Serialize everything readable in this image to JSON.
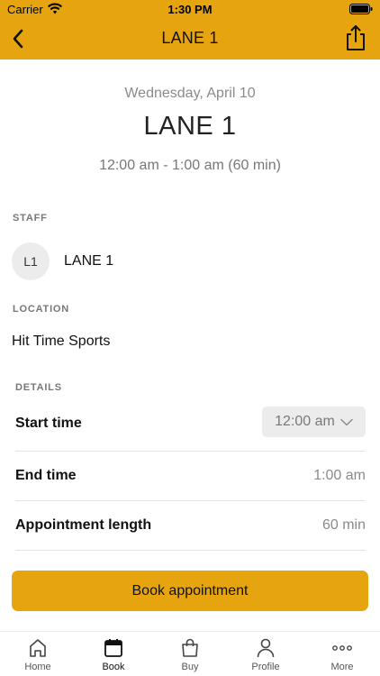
{
  "status_bar": {
    "carrier": "Carrier",
    "time": "1:30 PM"
  },
  "nav": {
    "title": "LANE 1",
    "back_icon": "chevron-left-icon",
    "share_icon": "share-icon"
  },
  "appointment": {
    "date": "Wednesday, April 10",
    "title": "LANE 1",
    "time_range": "12:00 am - 1:00 am (60 min)"
  },
  "staff": {
    "section_label": "STAFF",
    "initials": "L1",
    "name": "LANE 1"
  },
  "location": {
    "section_label": "LOCATION",
    "name": "Hit Time Sports"
  },
  "details": {
    "section_label": "DETAILS",
    "start_time": {
      "label": "Start time",
      "value": "12:00 am"
    },
    "end_time": {
      "label": "End time",
      "value": "1:00 am"
    },
    "length": {
      "label": "Appointment length",
      "value": "60 min"
    }
  },
  "book_button": {
    "label": "Book appointment"
  },
  "tabs": [
    {
      "label": "Home",
      "icon": "home-icon"
    },
    {
      "label": "Book",
      "icon": "calendar-icon"
    },
    {
      "label": "Buy",
      "icon": "shopping-bag-icon"
    },
    {
      "label": "Profile",
      "icon": "person-icon"
    },
    {
      "label": "More",
      "icon": "more-dots-icon"
    }
  ],
  "colors": {
    "accent": "#e6a50e",
    "muted_text": "#8a8a8a",
    "divider": "#e3e3e3"
  }
}
